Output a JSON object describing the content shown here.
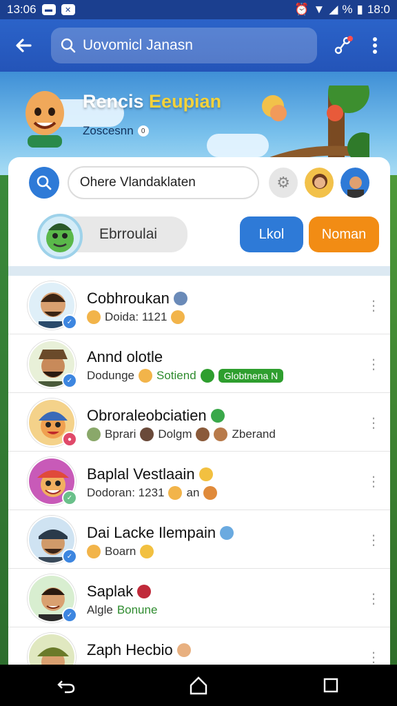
{
  "status_bar": {
    "time_left": "13:06",
    "battery": "%",
    "time_right": "18:0"
  },
  "app_bar": {
    "search_text": "Uovomicl Janasn"
  },
  "banner": {
    "title_main": "Rencis ",
    "title_accent": "Eeupian",
    "subtitle": "Zoscesnn"
  },
  "filter": {
    "input_text": "Ohere Vlandaklaten"
  },
  "chip": {
    "label": "Ebrroulai"
  },
  "buttons": {
    "blue_label": "Lkol",
    "orange_label": "Noman"
  },
  "colors": {
    "primary": "#2e7ad7",
    "orange": "#f28c14",
    "appbar": "#2b63c9",
    "green": "#2e8b2e"
  },
  "contacts": [
    {
      "name": "Cobhroukan",
      "sub": "Doida: 1121",
      "avatar": "man-beard"
    },
    {
      "name": "Annd olotle",
      "sub_a": "Dodunge",
      "sub_b": "Sotiend",
      "tag": "Globtnena N",
      "avatar": "man-hat"
    },
    {
      "name": "Obroraleobciatien",
      "items": [
        "Bprari",
        "Dolgm",
        "Zberand"
      ],
      "avatar": "cartoon-kid"
    },
    {
      "name": "Baplal Vestlaain",
      "sub_a": "Dodoran: 1231",
      "sub_b": "an",
      "avatar": "cartoon-clown"
    },
    {
      "name": "Dai Lacke Ilempain",
      "sub": "Boarn",
      "avatar": "man-cap"
    },
    {
      "name": "Saplak",
      "sub_a": "Algle",
      "sub_b": "Bonune",
      "avatar": "man-smile"
    },
    {
      "name": "Zaph Hecbio",
      "avatar": "man-helmet"
    }
  ]
}
